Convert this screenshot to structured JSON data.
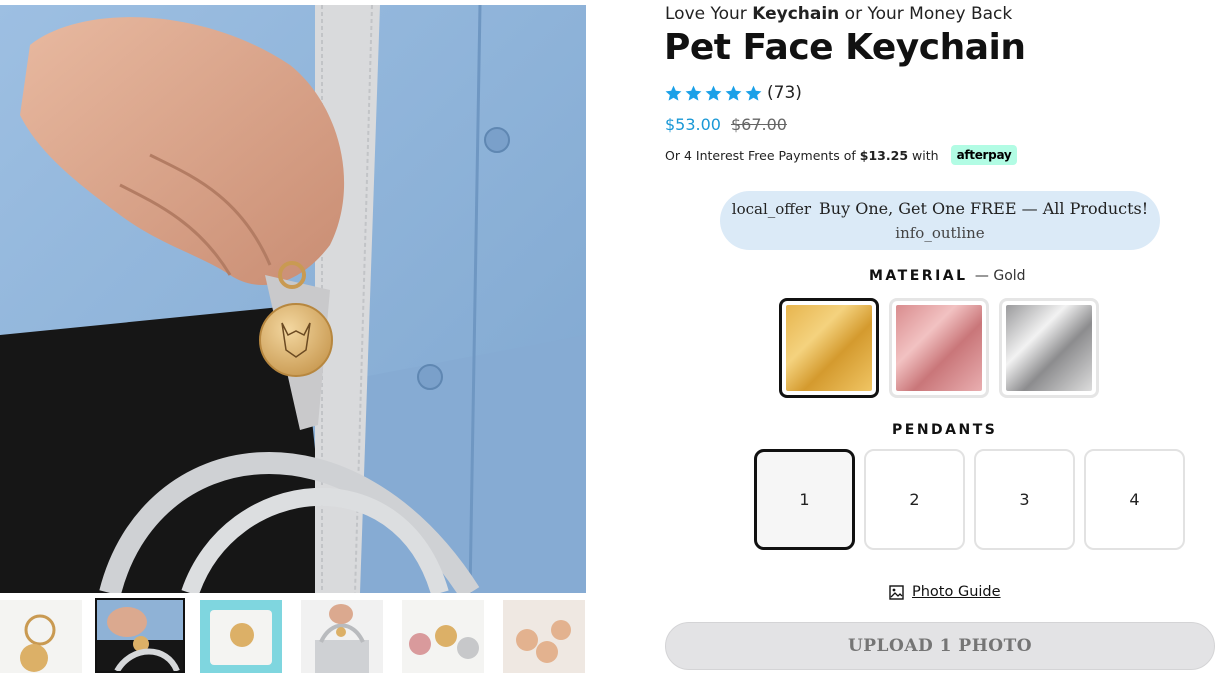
{
  "tagline": {
    "before": "Love Your ",
    "bold": "Keychain",
    "after": " or Your Money Back"
  },
  "product": {
    "title": "Pet Face Keychain",
    "rating_stars": 5,
    "review_count": "(73)",
    "price_current": "$53.00",
    "price_original": "$67.00"
  },
  "installments": {
    "prefix": "Or 4 Interest Free Payments of",
    "amount": "$13.25",
    "suffix": "with",
    "provider": "afterpay"
  },
  "promo": {
    "icon_text": "local_offer",
    "text": "Buy One, Get One FREE — All Products!",
    "info_icon_text": "info_outline"
  },
  "material": {
    "label": "MATERIAL",
    "selected_text": "— Gold",
    "options": [
      {
        "name": "gold",
        "color": "#d9a441"
      },
      {
        "name": "rose-gold",
        "color": "#d99a9c"
      },
      {
        "name": "silver",
        "color": "#b8b8ba"
      }
    ]
  },
  "pendants": {
    "label": "PENDANTS",
    "options": [
      "1",
      "2",
      "3",
      "4"
    ],
    "selected": "1"
  },
  "photo_guide": {
    "label": "Photo Guide"
  },
  "upload_button": {
    "label": "UPLOAD 1 PHOTO"
  },
  "colors": {
    "accent": "#1a98d6",
    "star": "#1aa0e8",
    "afterpay": "#b2fce4",
    "promo_bg": "#dbeaf7"
  }
}
